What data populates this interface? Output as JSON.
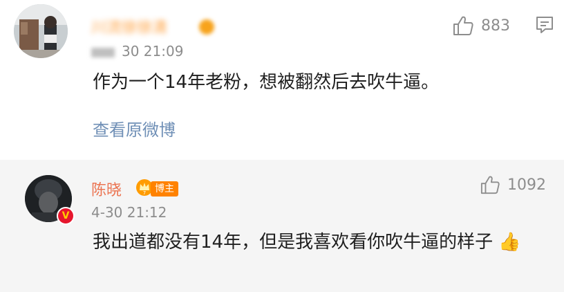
{
  "comments": [
    {
      "username": "川流徐徐清",
      "time": "4-30 21:09",
      "time_visible": "30 21:09",
      "text": "作为一个14年老粉，想被翻然后去吹牛逼。",
      "likes": "883",
      "view_original": "查看原微博"
    },
    {
      "username": "陈晓",
      "badge": "博主",
      "time": "4-30 21:12",
      "text": "我出道都没有14年，但是我喜欢看你吹牛逼的样子 👍",
      "likes": "1092"
    }
  ],
  "icons": {
    "like": "thumbs-up-icon",
    "reply": "comment-bubble-icon",
    "verified": "verified-v-icon",
    "crown": "crown-icon"
  },
  "colors": {
    "username_orange": "#ff8200",
    "blogger_name": "#eb7350",
    "link_blue": "#6f8fb6",
    "muted_gray": "#8c8c8c"
  }
}
